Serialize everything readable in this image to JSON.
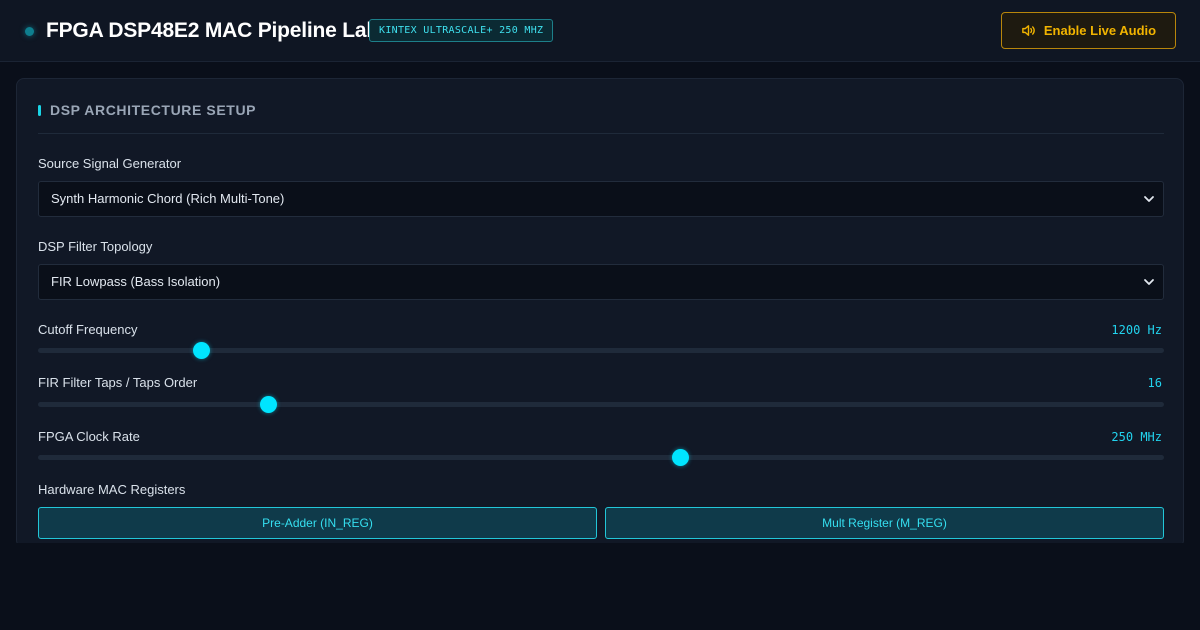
{
  "header": {
    "title": "FPGA DSP48E2 MAC Pipeline Lab",
    "chip": "KINTEX ULTRASCALE+ 250 MHZ",
    "audio_button": "Enable Live Audio"
  },
  "panel": {
    "title": "DSP ARCHITECTURE SETUP",
    "source": {
      "label": "Source Signal Generator",
      "value": "Synth Harmonic Chord (Rich Multi-Tone)"
    },
    "topology": {
      "label": "DSP Filter Topology",
      "value": "FIR Lowpass (Bass Isolation)"
    },
    "sliders": [
      {
        "label": "Cutoff Frequency",
        "readout": "1200 Hz",
        "fraction": 0.145
      },
      {
        "label": "FIR Filter Taps / Taps Order",
        "readout": "16",
        "fraction": 0.204
      },
      {
        "label": "FPGA Clock Rate",
        "readout": "250 MHz",
        "fraction": 0.57
      }
    ],
    "registers": {
      "label": "Hardware MAC Registers",
      "buttons": [
        "Pre-Adder (IN_REG)",
        "Mult Register (M_REG)"
      ]
    }
  },
  "colors": {
    "accent": "#00e5ff",
    "audio": "#f2b400"
  }
}
